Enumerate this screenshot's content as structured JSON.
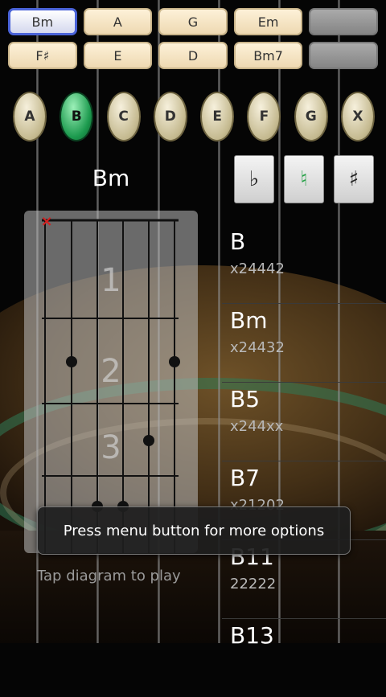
{
  "chord_buttons": [
    [
      {
        "label": "Bm",
        "selected": true
      },
      {
        "label": "A"
      },
      {
        "label": "G"
      },
      {
        "label": "Em"
      },
      {
        "label": "",
        "empty": true
      }
    ],
    [
      {
        "label": "F♯"
      },
      {
        "label": "E"
      },
      {
        "label": "D"
      },
      {
        "label": "Bm7"
      },
      {
        "label": "",
        "empty": true
      }
    ]
  ],
  "notes": [
    "A",
    "B",
    "C",
    "D",
    "E",
    "F",
    "G",
    "X"
  ],
  "selected_note": "B",
  "chord_title": "Bm",
  "accidentals": {
    "flat": "♭",
    "natural": "♮",
    "sharp": "♯",
    "selected": "natural"
  },
  "diagram": {
    "fret_numbers": [
      "1",
      "2",
      "3"
    ],
    "muted_string_marker": "×",
    "fingering": "x24432"
  },
  "tap_hint": "Tap diagram to play",
  "chord_list": [
    {
      "name": "B",
      "fingering": "x24442"
    },
    {
      "name": "Bm",
      "fingering": "x24432"
    },
    {
      "name": "B5",
      "fingering": "x244xx"
    },
    {
      "name": "B7",
      "fingering": "x21202"
    },
    {
      "name": "B11",
      "fingering": "22222"
    },
    {
      "name": "B13",
      "fingering": ""
    }
  ],
  "toast": "Press menu button for more options",
  "colors": {
    "selected_note": "#1c9a4e",
    "selected_chord_border": "#4a63d8",
    "natural_green": "#27a148"
  }
}
